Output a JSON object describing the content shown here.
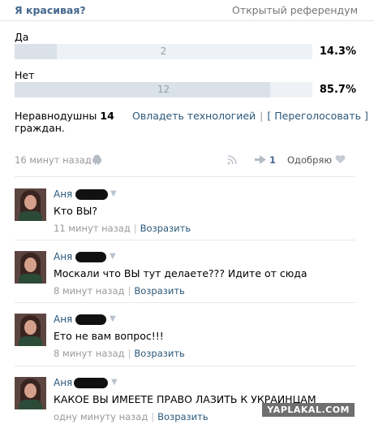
{
  "poll": {
    "question": "Я красивая?",
    "type": "Открытый референдум",
    "options": [
      {
        "label": "Да",
        "count": "2",
        "percent": "14.3%",
        "fraction": 0.143
      },
      {
        "label": "Нет",
        "count": "12",
        "percent": "85.7%",
        "fraction": 0.857
      }
    ],
    "voters_prefix": "Неравнодушны",
    "voters_count": "14",
    "voters_suffix": "граждан.",
    "link_tech": "Овладеть технологией",
    "link_revote": "[ Переголосовать ]"
  },
  "meta": {
    "time": "16 минут назад",
    "shares": "1",
    "like_label": "Одобряю"
  },
  "comments": [
    {
      "author": "Аня",
      "text": "Кто ВЫ?",
      "time": "11 минут назад",
      "reply": "Возразить"
    },
    {
      "author": "Аня",
      "text": "Москали что ВЫ тут делаете??? Идите от сюда",
      "time": "8 минут назад",
      "reply": "Возразить"
    },
    {
      "author": "Аня",
      "text": "Ето не вам вопрос!!!",
      "time": "8 минут назад",
      "reply": "Возразить"
    },
    {
      "author": "Аня",
      "text": "КАКОЕ ВЫ ИМЕЕТЕ ПРАВО ЛАЗИТЬ К УКРАИНЦАМ",
      "time": "одну минуту назад",
      "reply": "Возразить"
    }
  ],
  "watermark": "YAPLAKAL.COM",
  "colors": {
    "link": "#2b587a",
    "bar_bg": "#eef1f5",
    "bar_fill": "#dae1e8"
  },
  "icons": [
    "android-icon",
    "rss-icon",
    "share-icon",
    "heart-icon",
    "chevron-down-icon"
  ]
}
